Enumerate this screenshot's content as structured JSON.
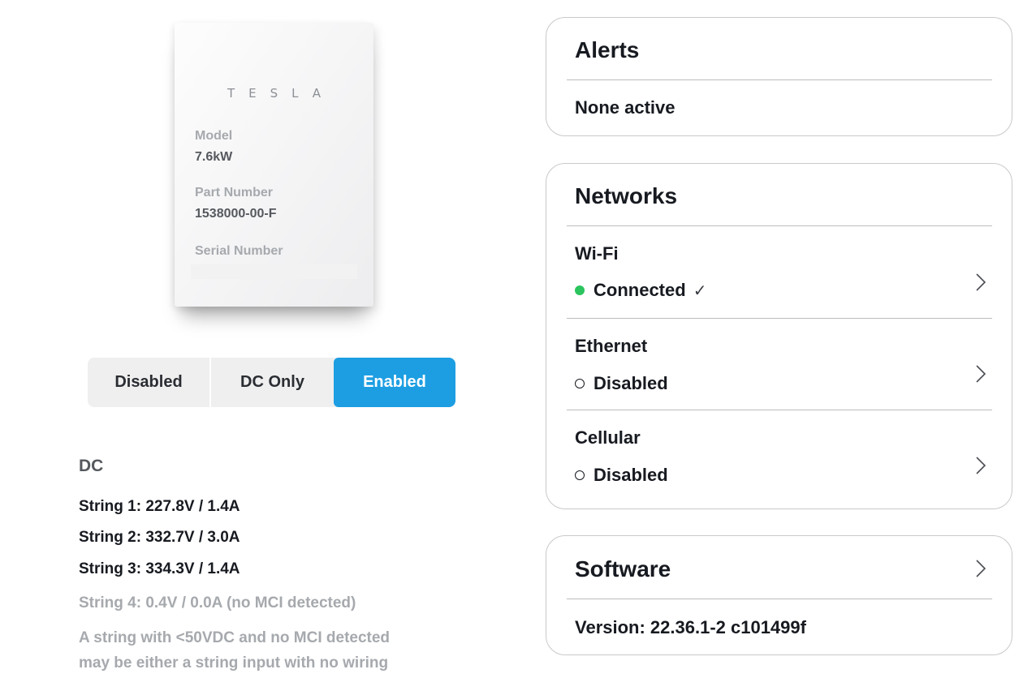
{
  "device": {
    "logo": "TESLA",
    "model_label": "Model",
    "model_value": "7.6kW",
    "part_label": "Part Number",
    "part_value": "1538000-00-F",
    "serial_label": "Serial Number"
  },
  "mode_selector": {
    "options": [
      "Disabled",
      "DC Only",
      "Enabled"
    ],
    "selected": "Enabled",
    "accent_color": "#1d9ee2"
  },
  "dc": {
    "title": "DC",
    "strings": [
      "String 1: 227.8V / 1.4A",
      "String 2: 332.7V / 3.0A",
      "String 3: 334.3V / 1.4A",
      "String 4: 0.4V / 0.0A (no MCI detected)"
    ],
    "note_line1": "A string with <50VDC and no MCI detected",
    "note_line2": "may be either a string input with no wiring"
  },
  "alerts": {
    "title": "Alerts",
    "status": "None active"
  },
  "networks": {
    "title": "Networks",
    "items": [
      {
        "label": "Wi-Fi",
        "status": "Connected",
        "icon": "green-dot-icon",
        "check": "✓"
      },
      {
        "label": "Ethernet",
        "status": "Disabled",
        "icon": "empty-circle-icon"
      },
      {
        "label": "Cellular",
        "status": "Disabled",
        "icon": "empty-circle-icon"
      }
    ],
    "connected_color": "#2bc45f"
  },
  "software": {
    "title": "Software",
    "version": "Version: 22.36.1-2 c101499f"
  }
}
